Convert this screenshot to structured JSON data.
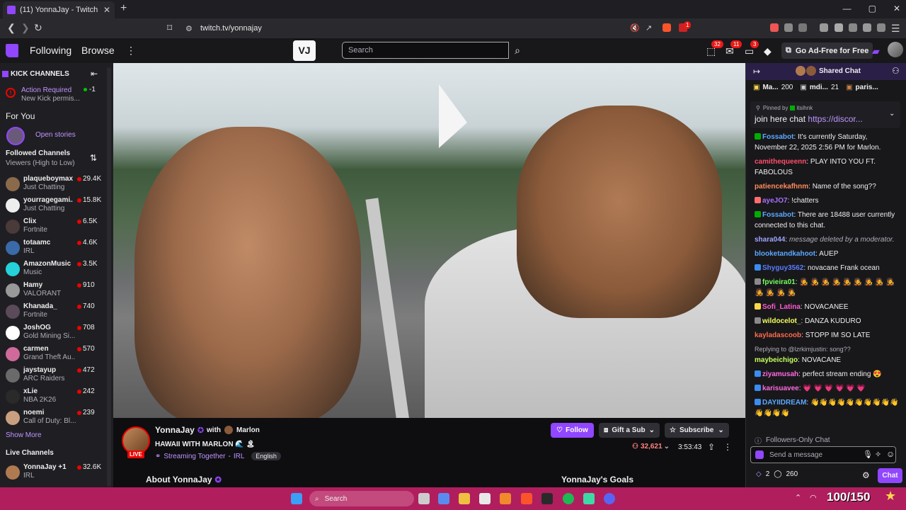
{
  "browser": {
    "tab_title": "(11) YonnaJay - Twitch",
    "url": "twitch.tv/yonnajay",
    "badge_shield": "1"
  },
  "topnav": {
    "following": "Following",
    "browse": "Browse",
    "search_placeholder": "Search",
    "badge_inbox": "32",
    "badge_notif": "11",
    "badge_whispers": "3",
    "ad_free": "Go Ad-Free for Free",
    "kick_glyph": "K⃝"
  },
  "sidebar": {
    "kick_header": "KICK CHANNELS",
    "action_title": "Action Required",
    "action_sub": "New Kick permis...",
    "action_count": "-1",
    "for_you": "For You",
    "open_stories": "Open stories",
    "followed": "Followed Channels",
    "sort": "Viewers (High to Low)",
    "channels": [
      {
        "name": "plaqueboymax",
        "game": "Just Chatting",
        "viewers": "29.4K",
        "color": "#8a6a4a"
      },
      {
        "name": "yourragegami...",
        "game": "Just Chatting",
        "viewers": "15.8K",
        "color": "#eeeeee"
      },
      {
        "name": "Clix",
        "game": "Fortnite",
        "viewers": "6.5K",
        "color": "#4a3a3a"
      },
      {
        "name": "totaamc",
        "game": "IRL",
        "viewers": "4.6K",
        "color": "#3a6aa8"
      },
      {
        "name": "AmazonMusic",
        "game": "Music",
        "viewers": "3.5K",
        "color": "#25d1da"
      },
      {
        "name": "Hamy",
        "game": "VALORANT",
        "viewers": "910",
        "color": "#999999"
      },
      {
        "name": "Khanada_",
        "game": "Fortnite",
        "viewers": "740",
        "color": "#5a4a5a"
      },
      {
        "name": "JoshOG",
        "game": "Gold Mining Si...",
        "viewers": "708",
        "color": "#ffffff"
      },
      {
        "name": "carmen",
        "game": "Grand Theft Au...",
        "viewers": "570",
        "color": "#d06a9a"
      },
      {
        "name": "jaystayup",
        "game": "ARC Raiders",
        "viewers": "472",
        "color": "#6a6a6a"
      },
      {
        "name": "xLie",
        "game": "NBA 2K26",
        "viewers": "242",
        "color": "#2a2a2a"
      },
      {
        "name": "noemi",
        "game": "Call of Duty: Bl...",
        "viewers": "239",
        "color": "#c8a080"
      }
    ],
    "show_more": "Show More",
    "live_channels": "Live Channels",
    "live": [
      {
        "name": "YonnaJay +1",
        "game": "IRL",
        "viewers": "32.6K",
        "color": "#b07a50"
      }
    ]
  },
  "stream": {
    "streamer": "YonnaJay",
    "with_label": "with",
    "guest": "Marlon",
    "title": "HAWAII WITH MARLON 🌊 🏝",
    "together": "Streaming Together",
    "category": "IRL",
    "language": "English",
    "live": "LIVE",
    "follow": "Follow",
    "gift": "Gift a Sub",
    "subscribe": "Subscribe",
    "viewers": "32,621",
    "uptime": "3:53:43",
    "about": "About YonnaJay",
    "goals": "YonnaJay's Goals"
  },
  "chat": {
    "header": "Shared Chat",
    "leaders": [
      {
        "name": "Ma...",
        "value": "200"
      },
      {
        "name": "mdi...",
        "value": "21"
      },
      {
        "name": "paris...",
        "value": ""
      }
    ],
    "pinned_by_label": "Pinned by",
    "pinned_by": "itsihnk",
    "pinned_text": "join here chat",
    "pinned_link": "https://discor...",
    "messages": [
      {
        "user": "Fossabot",
        "color": "#5ca8ff",
        "text": "It's currently Saturday, November 22, 2025 2:56 PM for Marlon.",
        "badge": "#00ad03"
      },
      {
        "user": "camithequeenn",
        "color": "#ff4d6a",
        "text": "PLAY INTO YOU FT. FABOLOUS",
        "badge": ""
      },
      {
        "user": "patiencekafhnm",
        "color": "#ff8a5c",
        "text": "Name of the song??",
        "badge": ""
      },
      {
        "user": "ayeJO7",
        "color": "#a970ff",
        "text": "!chatters",
        "badge": "#ff6e6e"
      },
      {
        "user": "Fossabot",
        "color": "#5ca8ff",
        "text": "There are 18488 user currently connected to this chat.",
        "badge": "#00ad03"
      },
      {
        "user": "shara044",
        "color": "#9fa4ff",
        "text": "message deleted by a moderator.",
        "badge": "",
        "italic": true
      },
      {
        "user": "blooketandkahoot",
        "color": "#5ca8ff",
        "text": "AUEP",
        "badge": ""
      },
      {
        "user": "Shyguy3562",
        "color": "#5c7bff",
        "text": "novacane Frank ocean",
        "badge": "#3b8cf0"
      },
      {
        "user": "fpvieira01",
        "color": "#74ff5c",
        "text": "🧑‍🎤 🧑‍🎤 🧑‍🎤 🧑‍🎤 🧑‍🎤 🧑‍🎤 🧑‍🎤 🧑‍🎤 🧑‍🎤 🧑‍🎤 🧑‍🎤 🧑‍🎤 🧑‍🎤",
        "badge": "#8a8a8a"
      },
      {
        "user": "Sofi_Latina",
        "color": "#ff5ccf",
        "text": "NOVACANEE",
        "badge": "#ffd84a"
      },
      {
        "user": "wildocelot_",
        "color": "#f5ff5c",
        "text": "DANZA KUDURO",
        "badge": "#8a8a8a"
      },
      {
        "user": "kayladascoob",
        "color": "#ff6a4a",
        "text": "STOPP IM SO LATE",
        "badge": ""
      },
      {
        "user": "maybeichigo",
        "color": "#c7ff5c",
        "text": "NOVACANE",
        "badge": "",
        "reply": "Replying to @lzrkimjustin: song??"
      },
      {
        "user": "ziyamusah",
        "color": "#ff6ae0",
        "text": "perfect stream ending 😍",
        "badge": "#3b8cf0"
      },
      {
        "user": "karisuavee",
        "color": "#ff6ae0",
        "text": "💗 💗 💗 💗 💗 💗",
        "badge": "#3b8cf0"
      },
      {
        "user": "DAYIIDREAM",
        "color": "#5ca8ff",
        "text": "👋👋👋👋👋👋👋👋👋👋👋👋👋👋",
        "badge": "#3b8cf0"
      }
    ],
    "followers_only": "Followers-Only Chat",
    "input_placeholder": "Send a message",
    "points_a": "2",
    "points_b": "260",
    "chat_btn": "Chat"
  },
  "taskbar": {
    "search": "Search",
    "counter": "100/150"
  },
  "colors": {
    "accent": "#9146ff",
    "live": "#eb0400",
    "taskbar": "#b01e5e"
  }
}
